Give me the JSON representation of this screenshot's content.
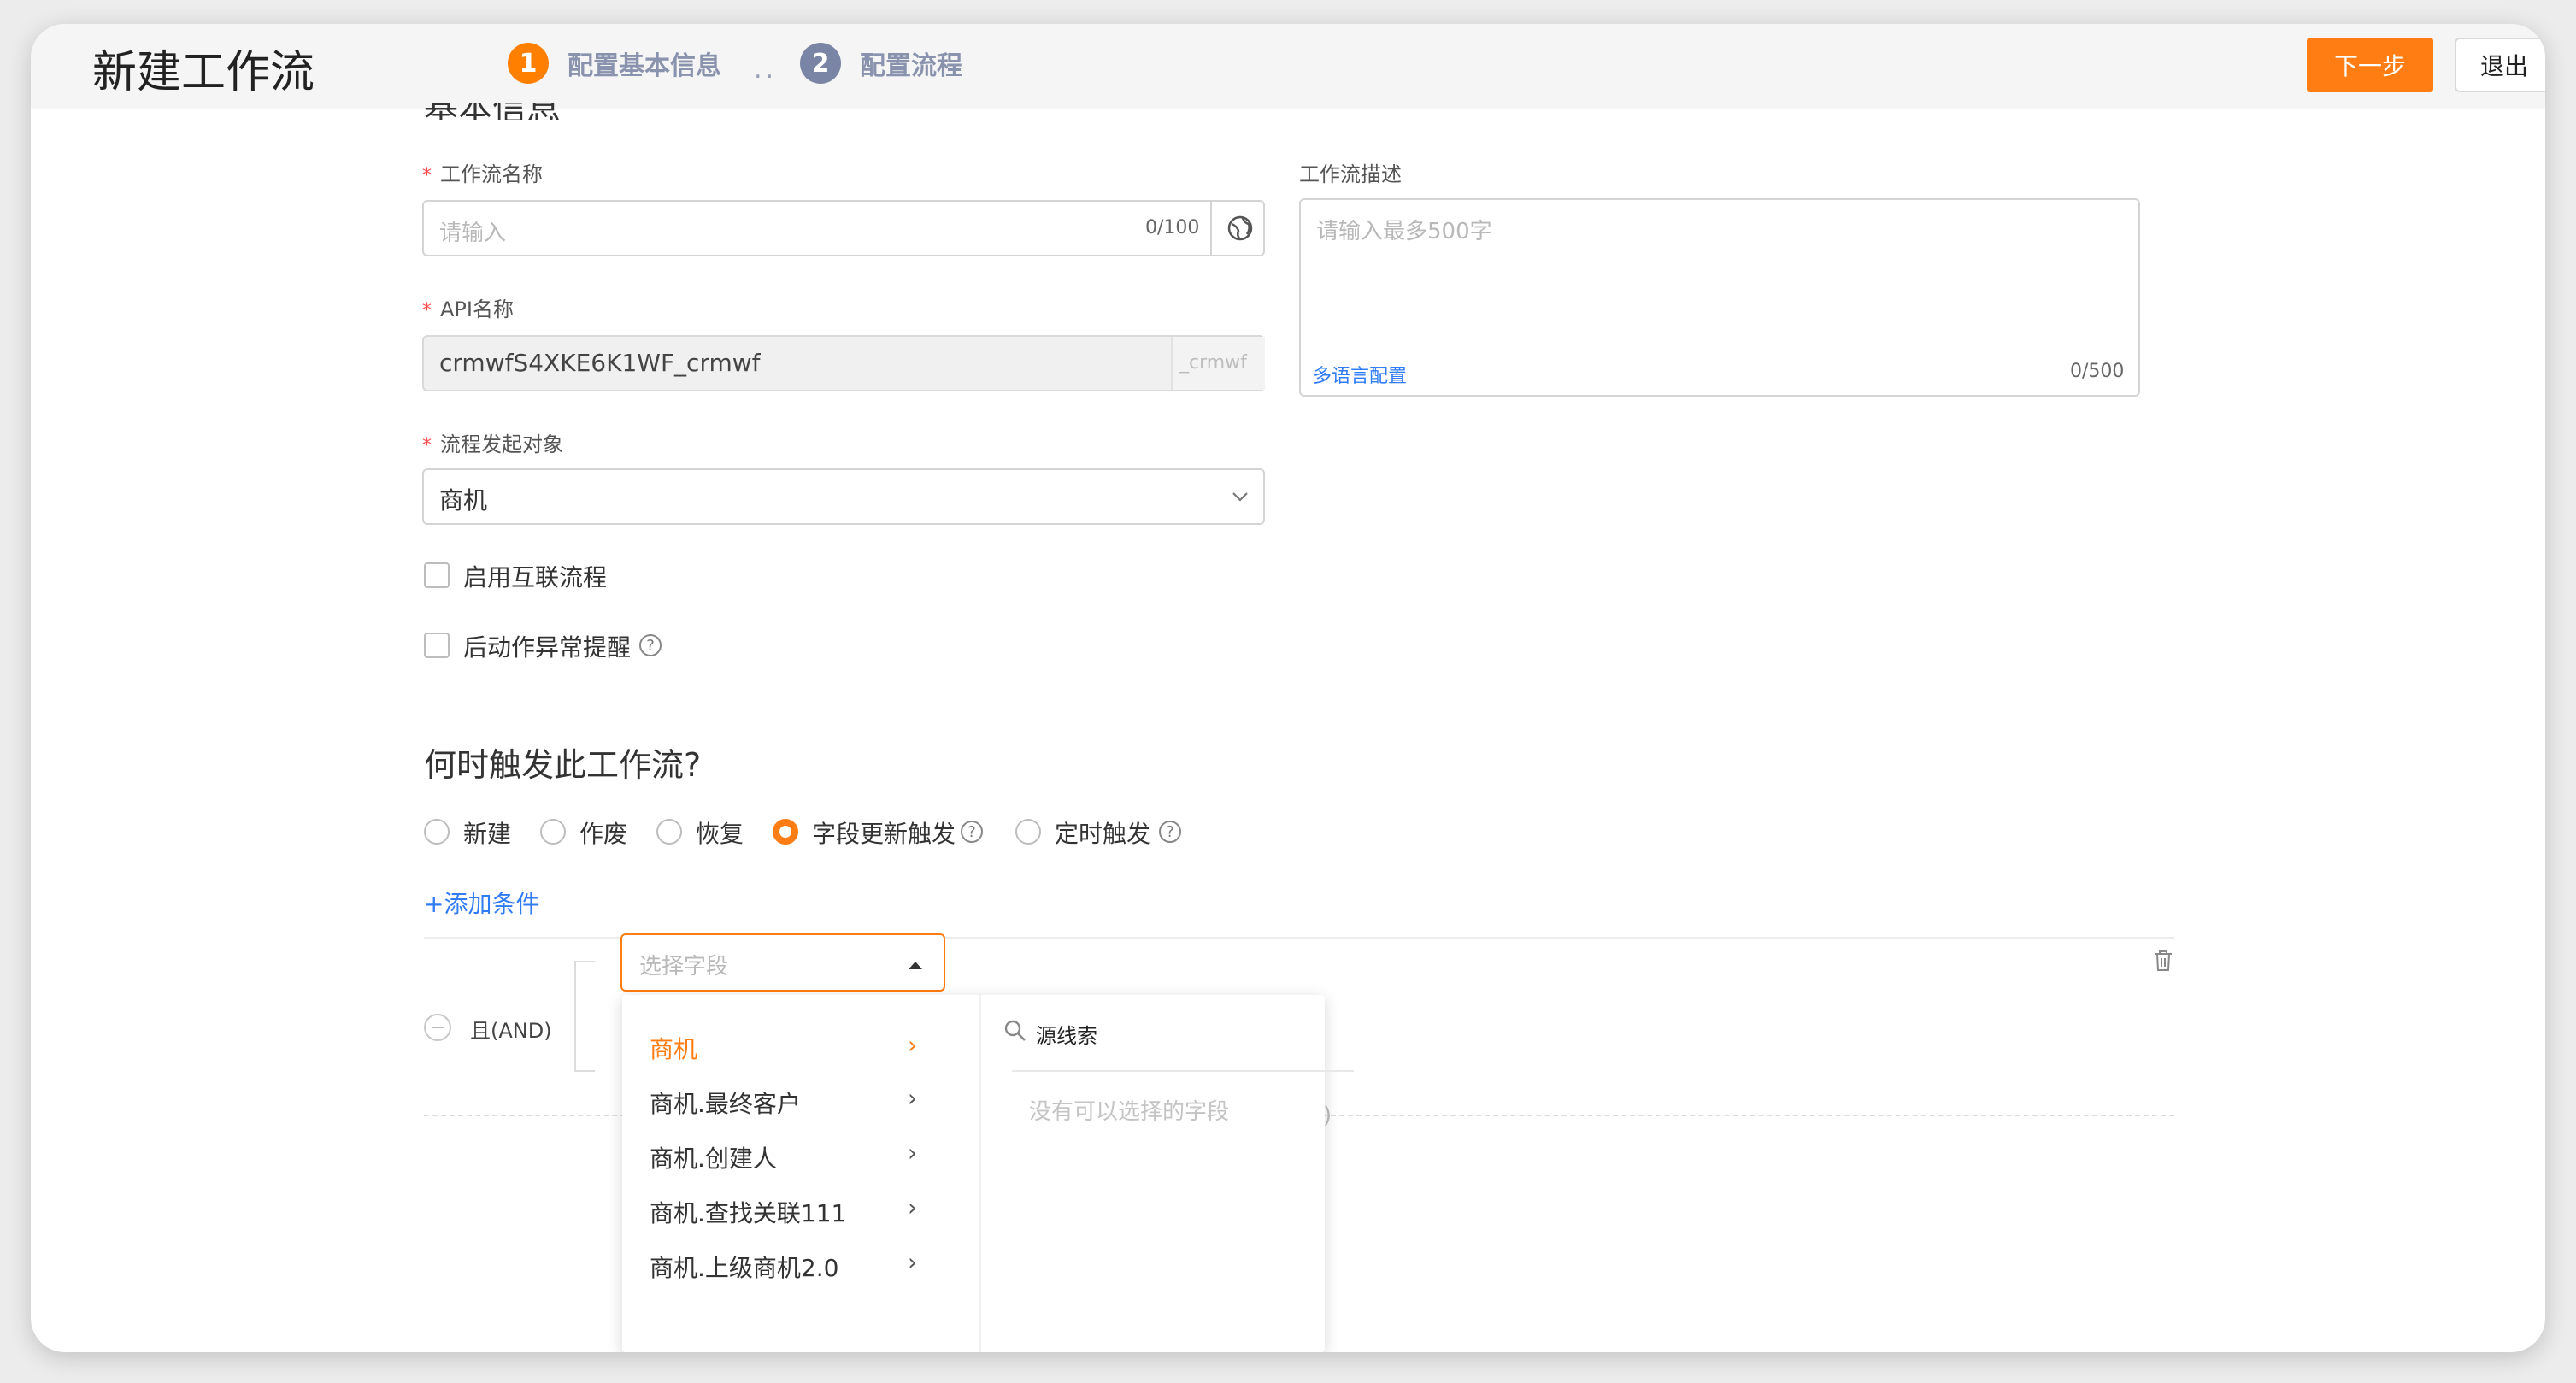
{
  "header": {
    "title": "新建工作流",
    "steps": [
      {
        "num": "1",
        "label": "配置基本信息"
      },
      {
        "num": "2",
        "label": "配置流程"
      }
    ],
    "step_separator": "..",
    "next_label": "下一步",
    "exit_label": "退出"
  },
  "basic": {
    "section_title": "基本信息",
    "name": {
      "label": "工作流名称",
      "placeholder": "请输入",
      "count": "0/100"
    },
    "api": {
      "label": "API名称",
      "value": "crmwfS4XKE6K1WF_crmwf",
      "suffix": "_crmwf"
    },
    "object": {
      "label": "流程发起对象",
      "value": "商机"
    },
    "desc": {
      "label": "工作流描述",
      "placeholder": "请输入最多500字",
      "link": "多语言配置",
      "count": "0/500"
    },
    "checkboxes": [
      {
        "label": "启用互联流程"
      },
      {
        "label": "后动作异常提醒"
      }
    ]
  },
  "trigger": {
    "title": "何时触发此工作流?",
    "options": [
      {
        "label": "新建",
        "checked": false
      },
      {
        "label": "作废",
        "checked": false
      },
      {
        "label": "恢复",
        "checked": false
      },
      {
        "label": "字段更新触发",
        "checked": true
      },
      {
        "label": "定时触发",
        "checked": false
      }
    ],
    "add_condition": "+添加条件",
    "logic_label": "且(AND)",
    "field_select_placeholder": "选择字段",
    "hidden_paren": ")"
  },
  "dropdown": {
    "items": [
      {
        "label": "商机",
        "active": true
      },
      {
        "label": "商机.最终客户",
        "active": false
      },
      {
        "label": "商机.创建人",
        "active": false
      },
      {
        "label": "商机.查找关联111",
        "active": false
      },
      {
        "label": "商机.上级商机2.0",
        "active": false
      }
    ],
    "search_value": "源线索",
    "empty_text": "没有可以选择的字段"
  },
  "colors": {
    "accent": "#ff7d12",
    "link": "#2f7cf6",
    "step_inactive": "#7a84a4"
  }
}
